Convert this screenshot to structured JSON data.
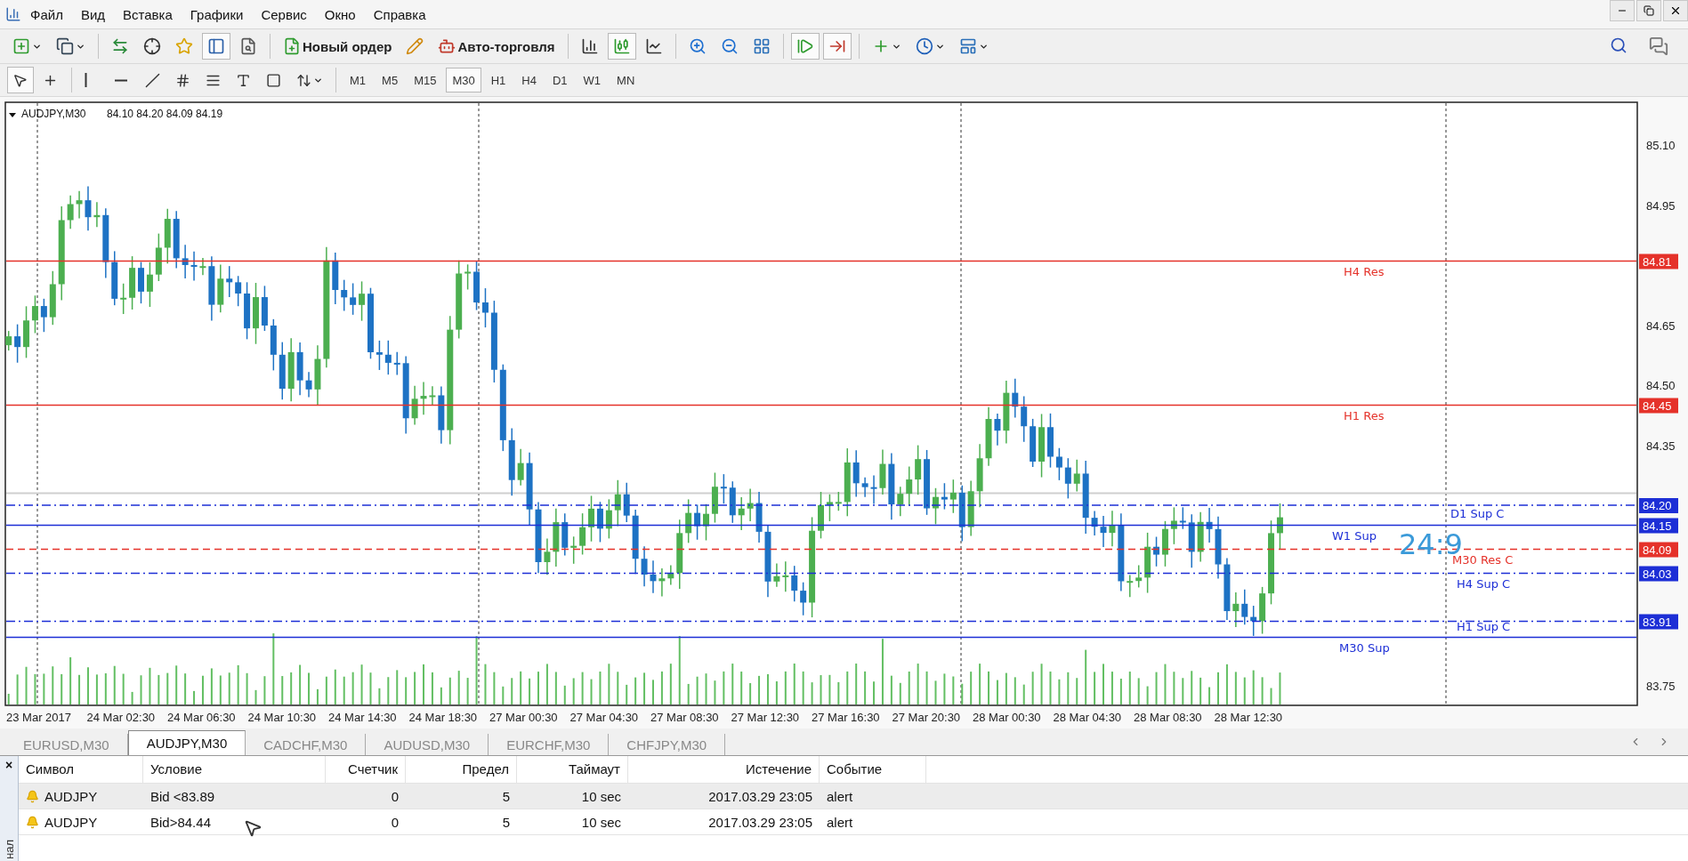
{
  "menu": [
    "Файл",
    "Вид",
    "Вставка",
    "Графики",
    "Сервис",
    "Окно",
    "Справка"
  ],
  "main_toolbar": [
    {
      "kind": "icon",
      "pressed": false,
      "menu": true
    },
    {
      "kind": "icon",
      "pressed": false,
      "menu": true
    },
    {
      "kind": "sep"
    },
    {
      "kind": "icon",
      "pressed": false,
      "menu": false
    },
    {
      "kind": "icon",
      "pressed": false,
      "menu": false
    },
    {
      "kind": "icon",
      "pressed": false,
      "menu": false
    },
    {
      "kind": "icon",
      "pressed": true,
      "menu": false
    },
    {
      "kind": "icon",
      "pressed": false,
      "menu": false
    },
    {
      "kind": "sep"
    },
    {
      "kind": "button",
      "label": "Новый ордер"
    },
    {
      "kind": "icon",
      "pressed": false,
      "menu": false
    },
    {
      "kind": "button",
      "label": "Авто-торговля"
    },
    {
      "kind": "sep"
    },
    {
      "kind": "icon",
      "pressed": false,
      "menu": false
    },
    {
      "kind": "icon",
      "pressed": true,
      "menu": false
    },
    {
      "kind": "icon",
      "pressed": false,
      "menu": false
    },
    {
      "kind": "sep"
    },
    {
      "kind": "icon",
      "pressed": false,
      "menu": false
    },
    {
      "kind": "icon",
      "pressed": false,
      "menu": false
    },
    {
      "kind": "icon",
      "pressed": false,
      "menu": false
    },
    {
      "kind": "sep"
    },
    {
      "kind": "icon",
      "pressed": true,
      "menu": false
    },
    {
      "kind": "icon",
      "pressed": true,
      "menu": false
    },
    {
      "kind": "sep"
    },
    {
      "kind": "icon",
      "pressed": false,
      "menu": true
    },
    {
      "kind": "icon",
      "pressed": false,
      "menu": true
    },
    {
      "kind": "icon",
      "pressed": false,
      "menu": true
    }
  ],
  "draw_toolbar": [
    {
      "pressed": true,
      "menu": false
    },
    {
      "pressed": false,
      "menu": false
    },
    {
      "pressed": false,
      "menu": false
    },
    {
      "pressed": false,
      "menu": false
    },
    {
      "pressed": false,
      "menu": false
    },
    {
      "pressed": false,
      "menu": false
    },
    {
      "pressed": false,
      "menu": false
    },
    {
      "pressed": false,
      "menu": false
    },
    {
      "pressed": false,
      "menu": false
    },
    {
      "pressed": false,
      "menu": true
    }
  ],
  "timeframes": [
    {
      "label": "M1",
      "selected": false
    },
    {
      "label": "M5",
      "selected": false
    },
    {
      "label": "M15",
      "selected": false
    },
    {
      "label": "M30",
      "selected": true
    },
    {
      "label": "H1",
      "selected": false
    },
    {
      "label": "H4",
      "selected": false
    },
    {
      "label": "D1",
      "selected": false
    },
    {
      "label": "W1",
      "selected": false
    },
    {
      "label": "MN",
      "selected": false
    }
  ],
  "chart": {
    "symbol": "AUDJPY,M30",
    "ohlc": "84.10 84.20 84.09 84.19",
    "timer": "24:9",
    "price_ticks": [
      "85.10",
      "84.95",
      "84.65",
      "84.50",
      "84.35",
      "83.75"
    ],
    "levels": [
      {
        "label": "H4 Res",
        "price": "84.81",
        "color": "#e5322a"
      },
      {
        "label": "H1 Res",
        "price": "84.45",
        "color": "#e5322a"
      },
      {
        "label": "D1 Sup C",
        "price": "84.20",
        "color": "#1d2fd6"
      },
      {
        "label": "W1 Sup",
        "price": "84.15",
        "color": "#1d2fd6"
      },
      {
        "label": "M30 Res C",
        "price": "84.09",
        "color": "#e5322a"
      },
      {
        "label": "H4 Sup C",
        "price": "84.03",
        "color": "#1d2fd6"
      },
      {
        "label": "H1 Sup C",
        "price": "83.91",
        "color": "#1d2fd6"
      },
      {
        "label": "M30 Sup",
        "color": "#1d2fd6"
      }
    ],
    "time_labels": [
      "23 Mar 2017",
      "24 Mar 02:30",
      "24 Mar 06:30",
      "24 Mar 10:30",
      "24 Mar 14:30",
      "24 Mar 18:30",
      "27 Mar 00:30",
      "27 Mar 04:30",
      "27 Mar 08:30",
      "27 Mar 12:30",
      "27 Mar 16:30",
      "27 Mar 20:30",
      "28 Mar 00:30",
      "28 Mar 04:30",
      "28 Mar 08:30",
      "28 Mar 12:30"
    ]
  },
  "chart_tabs": [
    {
      "label": "EURUSD,M30",
      "selected": false
    },
    {
      "label": "AUDJPY,M30",
      "selected": true
    },
    {
      "label": "CADCHF,M30",
      "selected": false
    },
    {
      "label": "AUDUSD,M30",
      "selected": false
    },
    {
      "label": "EURCHF,M30",
      "selected": false
    },
    {
      "label": "CHFJPY,M30",
      "selected": false
    }
  ],
  "terminal": {
    "close": "×",
    "side_label": "нал",
    "columns": [
      "Символ",
      "Условие",
      "Счетчик",
      "Предел",
      "Таймаут",
      "Истечение",
      "Событие"
    ],
    "rows": [
      {
        "selected": true,
        "cells": [
          "AUDJPY",
          "Bid <83.89",
          "0",
          "5",
          "10 sec",
          "2017.03.29 23:05",
          "alert"
        ]
      },
      {
        "selected": false,
        "cells": [
          "AUDJPY",
          "Bid>84.44",
          "0",
          "5",
          "10 sec",
          "2017.03.29 23:05",
          "alert"
        ]
      }
    ]
  }
}
